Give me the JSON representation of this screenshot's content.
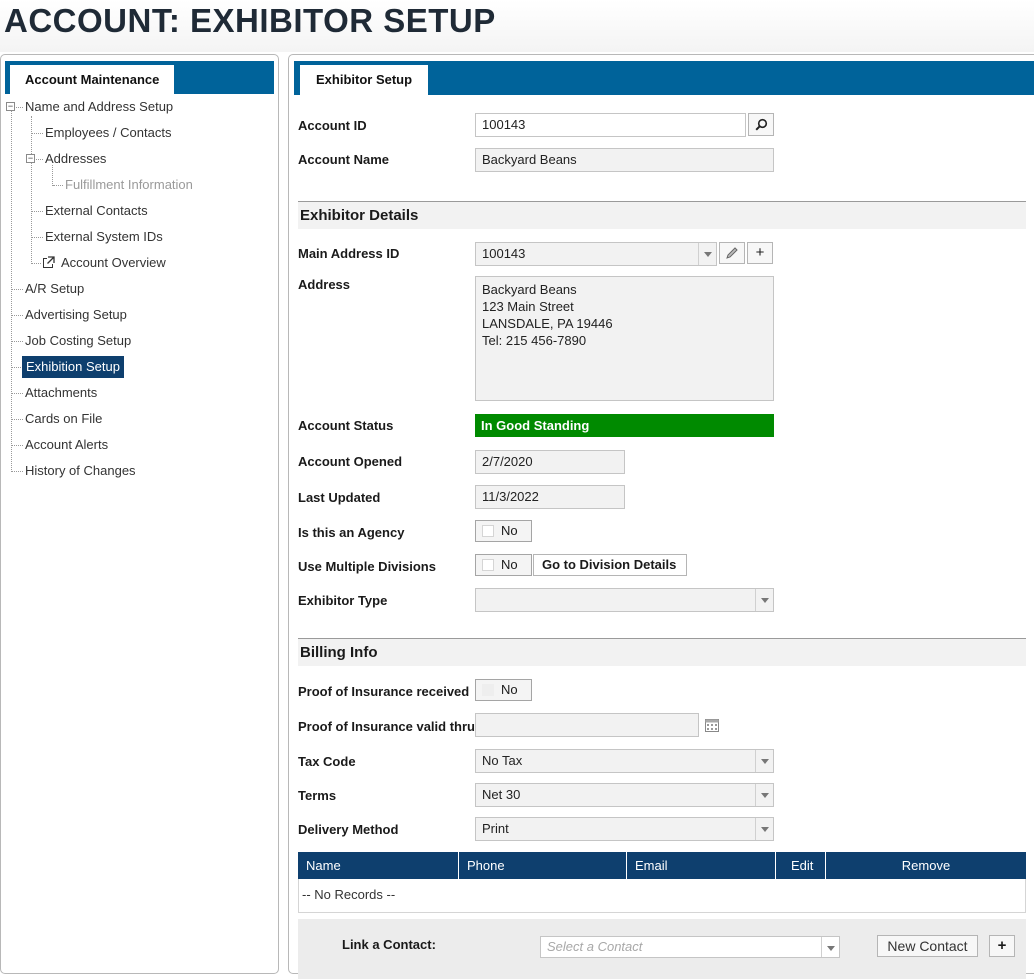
{
  "page": {
    "title": "ACCOUNT: EXHIBITOR SETUP"
  },
  "sidebar": {
    "tab_label": "Account Maintenance",
    "items": [
      {
        "label": "Name and Address Setup"
      },
      {
        "label": "Employees / Contacts"
      },
      {
        "label": "Addresses"
      },
      {
        "label": "Fulfillment Information"
      },
      {
        "label": "External Contacts"
      },
      {
        "label": "External System IDs"
      },
      {
        "label": "Account Overview"
      },
      {
        "label": "A/R Setup"
      },
      {
        "label": "Advertising Setup"
      },
      {
        "label": "Job Costing Setup"
      },
      {
        "label": "Exhibition Setup"
      },
      {
        "label": "Attachments"
      },
      {
        "label": "Cards on File"
      },
      {
        "label": "Account Alerts"
      },
      {
        "label": "History of Changes"
      }
    ]
  },
  "main": {
    "tab_label": "Exhibitor Setup",
    "account_id": {
      "label": "Account ID",
      "value": "100143"
    },
    "account_name": {
      "label": "Account Name",
      "value": "Backyard Beans"
    },
    "exhibitor_details": {
      "title": "Exhibitor Details",
      "main_address_id": {
        "label": "Main Address ID",
        "value": "100143"
      },
      "address": {
        "label": "Address",
        "lines": [
          "Backyard Beans",
          "123 Main Street",
          "LANSDALE, PA 19446",
          "Tel: 215 456-7890"
        ]
      },
      "account_status": {
        "label": "Account Status",
        "value": "In Good Standing",
        "color": "#008a00"
      },
      "account_opened": {
        "label": "Account Opened",
        "value": "2/7/2020"
      },
      "last_updated": {
        "label": "Last Updated",
        "value": "11/3/2022"
      },
      "is_agency": {
        "label": "Is this an Agency",
        "value": "No"
      },
      "multiple_divisions": {
        "label": "Use Multiple Divisions",
        "value": "No",
        "button": "Go to Division Details"
      },
      "exhibitor_type": {
        "label": "Exhibitor Type",
        "value": ""
      }
    },
    "billing": {
      "title": "Billing Info",
      "proof_insurance": {
        "label": "Proof of Insurance received",
        "value": "No"
      },
      "insurance_valid_thru": {
        "label": "Proof of Insurance valid thru",
        "value": ""
      },
      "tax_code": {
        "label": "Tax Code",
        "value": "No Tax"
      },
      "terms": {
        "label": "Terms",
        "value": "Net 30"
      },
      "delivery_method": {
        "label": "Delivery Method",
        "value": "Print"
      }
    },
    "contacts_grid": {
      "columns": [
        "Name",
        "Phone",
        "Email",
        "Edit",
        "Remove"
      ],
      "empty_text": "-- No Records --"
    },
    "link_contact": {
      "label": "Link a Contact:",
      "placeholder": "Select a Contact",
      "new_contact_button": "New Contact",
      "add_button": "+"
    }
  },
  "colors": {
    "accent": "#00639a",
    "grid_header": "#0e3f6e",
    "status_good": "#008a00"
  }
}
